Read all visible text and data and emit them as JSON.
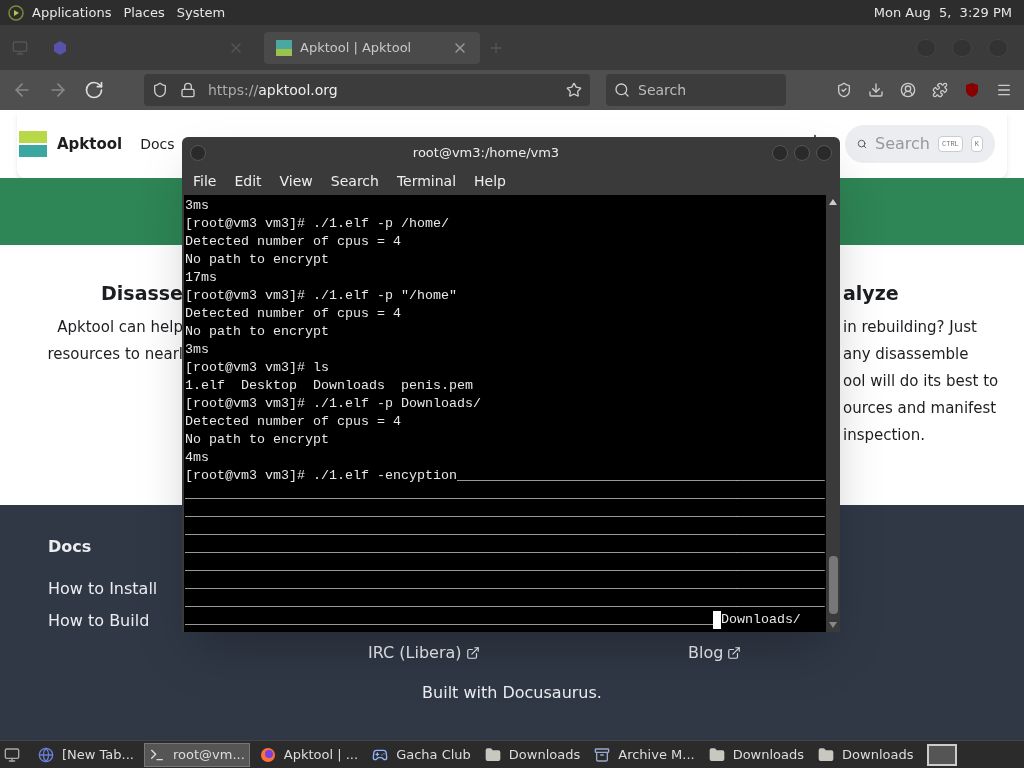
{
  "top_panel": {
    "menus": [
      "Applications",
      "Places",
      "System"
    ],
    "clock": "Mon Aug  5,  3:29 PM"
  },
  "browser": {
    "tabs": [
      {
        "kind": "faded",
        "selected": false
      },
      {
        "kind": "page",
        "label": "Apktool | Apktool",
        "selected": true
      }
    ],
    "url": {
      "scheme": "https://",
      "host": "apktool.org"
    },
    "search_placeholder": "Search"
  },
  "site": {
    "brand": "Apktool",
    "nav": [
      "Docs"
    ],
    "search": {
      "placeholder": "Search",
      "keys": [
        "CTRL",
        "K"
      ]
    },
    "left_feature": {
      "title": "Disasse",
      "lines": [
        "Apktool can help",
        "resources to nearl"
      ]
    },
    "right_feature": {
      "title": "alyze",
      "lines": [
        "in rebuilding? Just",
        "any disassemble",
        "ool will do its best to",
        "ources and manifest",
        "inspection."
      ]
    },
    "footer": {
      "heading": "Docs",
      "links": [
        "How to Install",
        "How to Build"
      ],
      "external_links": [
        "IRC (Libera)",
        "Blog"
      ],
      "credit": "Built with Docusaurus."
    }
  },
  "terminal": {
    "title": "root@vm3:/home/vm3",
    "menu": [
      "File",
      "Edit",
      "View",
      "Search",
      "Terminal",
      "Help"
    ],
    "lines": [
      {
        "text": "3ms"
      },
      {
        "text": "[root@vm3 vm3]# ./1.elf -p /home/"
      },
      {
        "text": "Detected number of cpus = 4"
      },
      {
        "text": "No path to encrypt"
      },
      {
        "text": "17ms"
      },
      {
        "text": "[root@vm3 vm3]# ./1.elf -p \"/home\""
      },
      {
        "text": "Detected number of cpus = 4"
      },
      {
        "text": "No path to encrypt"
      },
      {
        "text": "3ms"
      },
      {
        "text": "[root@vm3 vm3]# ls"
      },
      {
        "text": "1.elf  Desktop  Downloads  penis.pem"
      },
      {
        "text": "[root@vm3 vm3]# ./1.elf -p Downloads/"
      },
      {
        "text": "Detected number of cpus = 4"
      },
      {
        "text": "No path to encrypt"
      },
      {
        "text": "4ms"
      },
      {
        "text": "[root@vm3 vm3]# ./1.elf -encyption______________________________________________"
      },
      {
        "text": "________________________________________________________________________________"
      },
      {
        "text": "________________________________________________________________________________"
      },
      {
        "text": "________________________________________________________________________________"
      },
      {
        "text": "________________________________________________________________________________"
      },
      {
        "text": "________________________________________________________________________________"
      },
      {
        "text": "________________________________________________________________________________"
      },
      {
        "text": "________________________________________________________________________________"
      },
      {
        "text": "__________________________________________________________________",
        "cursor": true,
        "tail": "Downloads/"
      }
    ]
  },
  "taskbar": {
    "items": [
      {
        "kind": "browser",
        "label": "[New Tab...",
        "selected": false
      },
      {
        "kind": "terminal",
        "label": "root@vm...",
        "selected": true
      },
      {
        "kind": "firefox",
        "label": "Apktool | ...",
        "selected": false
      },
      {
        "kind": "game",
        "label": "Gacha Club",
        "selected": false
      },
      {
        "kind": "folder",
        "label": "Downloads",
        "selected": false
      },
      {
        "kind": "archive",
        "label": "Archive M...",
        "selected": false
      },
      {
        "kind": "folder",
        "label": "Downloads",
        "selected": false
      },
      {
        "kind": "folder",
        "label": "Downloads",
        "selected": false
      }
    ]
  }
}
